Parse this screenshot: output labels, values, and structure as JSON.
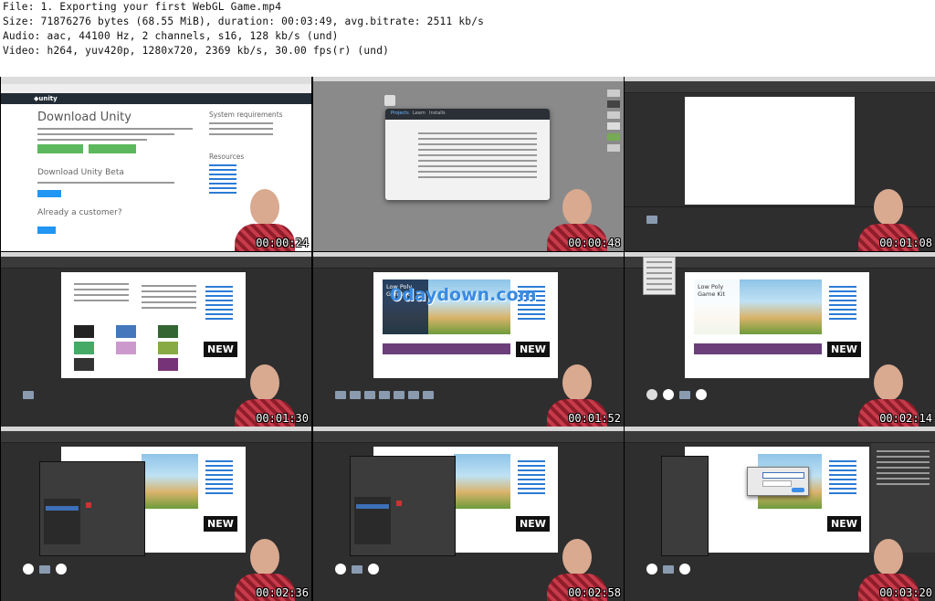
{
  "file_info": {
    "line1": "File: 1. Exporting your first WebGL Game.mp4",
    "line2": "Size: 71876276 bytes (68.55 MiB), duration: 00:03:49, avg.bitrate: 2511 kb/s",
    "line3": "Audio: aac, 44100 Hz, 2 channels, s16, 128 kb/s (und)",
    "line4": "Video: h264, yuv420p, 1280x720, 2369 kb/s, 30.00 fps(r) (und)"
  },
  "thumbnails": [
    {
      "timestamp": "00:00:24",
      "title": "Download Unity",
      "subtitle": "Download Unity Beta",
      "section": "Already a customer?",
      "side_title": "System requirements",
      "side_section": "Resources"
    },
    {
      "timestamp": "00:00:48",
      "tabs": [
        "Projects",
        "Learn",
        "Installs"
      ]
    },
    {
      "timestamp": "00:01:08"
    },
    {
      "timestamp": "00:01:30",
      "badge": "NEW"
    },
    {
      "timestamp": "00:01:52",
      "banner_title": "Low Poly Game Kit",
      "watermark": "0daydown.com",
      "badge": "NEW"
    },
    {
      "timestamp": "00:02:14",
      "banner_title": "Low Poly Game Kit",
      "badge": "NEW"
    },
    {
      "timestamp": "00:02:36",
      "badge": "NEW"
    },
    {
      "timestamp": "00:02:58",
      "badge": "NEW"
    },
    {
      "timestamp": "00:03:20",
      "badge": "NEW"
    }
  ],
  "colors": {
    "header_bg": "#ffffff",
    "sheet_bg": "#000000",
    "unity_dark": "#2e2e2e",
    "unity_green": "#5cb85c",
    "unity_blue": "#2196f3"
  }
}
